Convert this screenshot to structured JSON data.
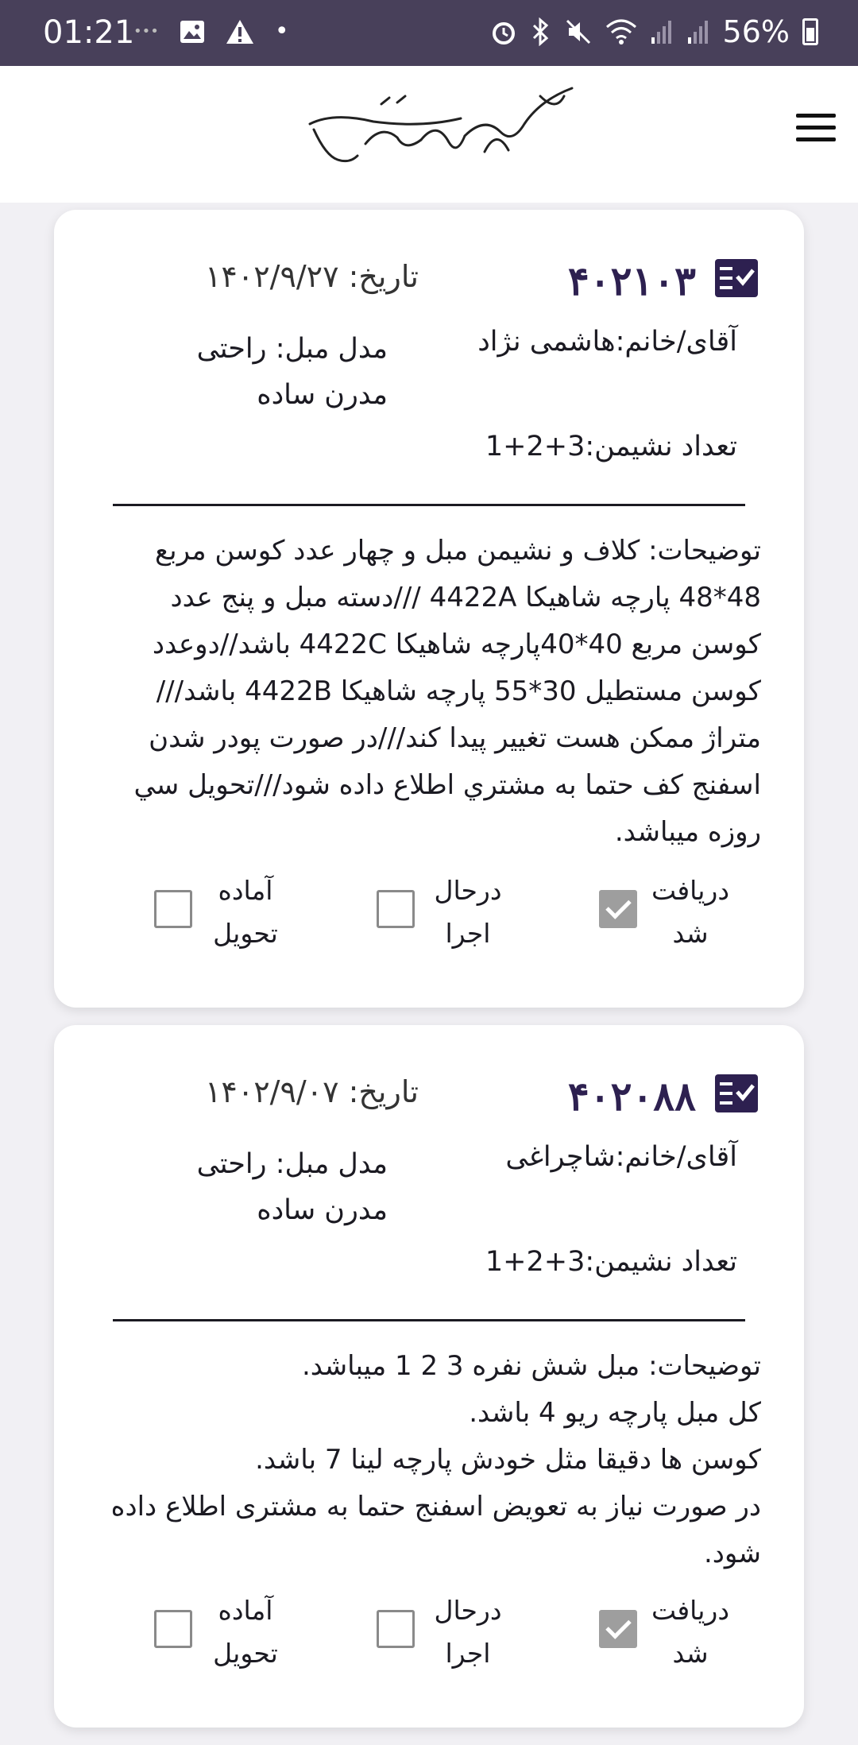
{
  "status_bar": {
    "time": "01:21",
    "battery": "56%",
    "left_icons": [
      "more-dots-icon",
      "gallery-icon",
      "warning-icon",
      "dot-icon"
    ],
    "right_icons": [
      "alarm-icon",
      "bluetooth-icon",
      "mute-icon",
      "wifi-icon",
      "signal-icon",
      "signal-icon",
      "battery-icon"
    ]
  },
  "header": {
    "logo_alt": "گالری مبل نفیس",
    "menu_icon": "hamburger-menu-icon"
  },
  "cards": [
    {
      "order_number": "۴۰۲۱۰۳",
      "date_label": "تاریخ:",
      "date": "۱۴۰۲/۹/۲۷",
      "customer_label": "آقای/خانم:",
      "customer": "هاشمی نژاد",
      "model_label": "مدل مبل:",
      "model": "راحتی مدرن ساده",
      "seats_label": "تعداد نشیمن:",
      "seats": "1+2+3",
      "description": "توضیحات: کلاف و نشیمن مبل و چهار عدد کوسن مربع 48*48 پارچه شاهیکا 4422A ///دسته مبل و پنج عدد کوسن مربع 40*40پارچه شاهیکا 4422C باشد//دوعدد کوسن مستطیل 30*55 پارچه شاهیکا 4422B باشد/// متراژ ممکن هست تغییر پیدا کند///در صورت پودر شدن اسفنج کف حتما به مشتري اطلاع داده شود///تحویل سي روزه میباشد.",
      "statuses": [
        {
          "label": "دریافت شد",
          "checked": true
        },
        {
          "label": "درحال اجرا",
          "checked": false
        },
        {
          "label": "آماده تحویل",
          "checked": false
        }
      ]
    },
    {
      "order_number": "۴۰۲۰۸۸",
      "date_label": "تاریخ:",
      "date": "۱۴۰۲/۹/۰۷",
      "customer_label": "آقای/خانم:",
      "customer": "شاچراغی",
      "model_label": "مدل مبل:",
      "model": "راحتی مدرن ساده",
      "seats_label": "تعداد نشیمن:",
      "seats": "1+2+3",
      "description_lines": [
        "توضیحات: مبل شش نفره 3 2 1 میباشد.",
        "کل مبل پارچه ریو 4 باشد.",
        "کوسن ها دقیقا مثل خودش پارچه لینا 7 باشد.",
        "در صورت نیاز به تعویض اسفنج حتما به مشتری اطلاع داده شود."
      ],
      "statuses": [
        {
          "label": "دریافت شد",
          "checked": true
        },
        {
          "label": "درحال اجرا",
          "checked": false
        },
        {
          "label": "آماده تحویل",
          "checked": false
        }
      ]
    }
  ]
}
